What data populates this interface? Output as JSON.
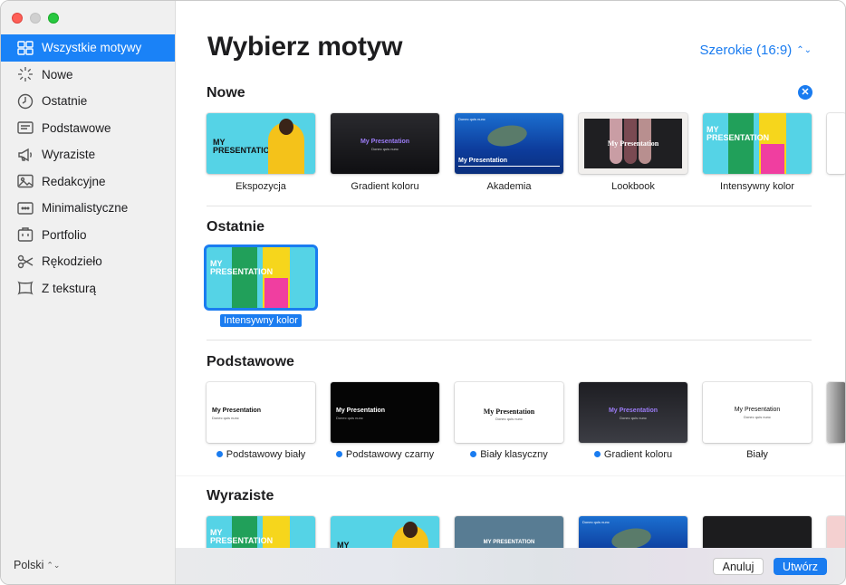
{
  "sidebar": {
    "items": [
      {
        "label": "Wszystkie motywy",
        "icon": "grid-icon"
      },
      {
        "label": "Nowe",
        "icon": "sparkle-icon"
      },
      {
        "label": "Ostatnie",
        "icon": "clock-icon"
      },
      {
        "label": "Podstawowe",
        "icon": "text-box-icon"
      },
      {
        "label": "Wyraziste",
        "icon": "megaphone-icon"
      },
      {
        "label": "Redakcyjne",
        "icon": "photo-icon"
      },
      {
        "label": "Minimalistyczne",
        "icon": "dots-box-icon"
      },
      {
        "label": "Portfolio",
        "icon": "portfolio-icon"
      },
      {
        "label": "Rękodzieło",
        "icon": "scissors-icon"
      },
      {
        "label": "Z teksturą",
        "icon": "texture-icon"
      }
    ],
    "language": "Polski"
  },
  "header": {
    "title": "Wybierz motyw",
    "size_select": "Szerokie (16:9)"
  },
  "sections": {
    "new": {
      "title": "Nowe",
      "items": [
        "Ekspozycja",
        "Gradient koloru",
        "Akademia",
        "Lookbook",
        "Intensywny kolor"
      ]
    },
    "recent": {
      "title": "Ostatnie",
      "items": [
        "Intensywny kolor"
      ]
    },
    "basic": {
      "title": "Podstawowe",
      "items": [
        "Podstawowy biały",
        "Podstawowy czarny",
        "Biały klasyczny",
        "Gradient koloru",
        "Biały"
      ]
    },
    "bold": {
      "title": "Wyraziste"
    }
  },
  "thumb_text": {
    "my_presentation_caps": "MY PRESENTATION",
    "my_presentation": "My Presentation",
    "subtitle": "Donec quis nunc"
  },
  "footer": {
    "cancel": "Anuluj",
    "create": "Utwórz"
  },
  "colors": {
    "accent": "#1a7cf0",
    "sidebar_active": "#1a82f7"
  }
}
